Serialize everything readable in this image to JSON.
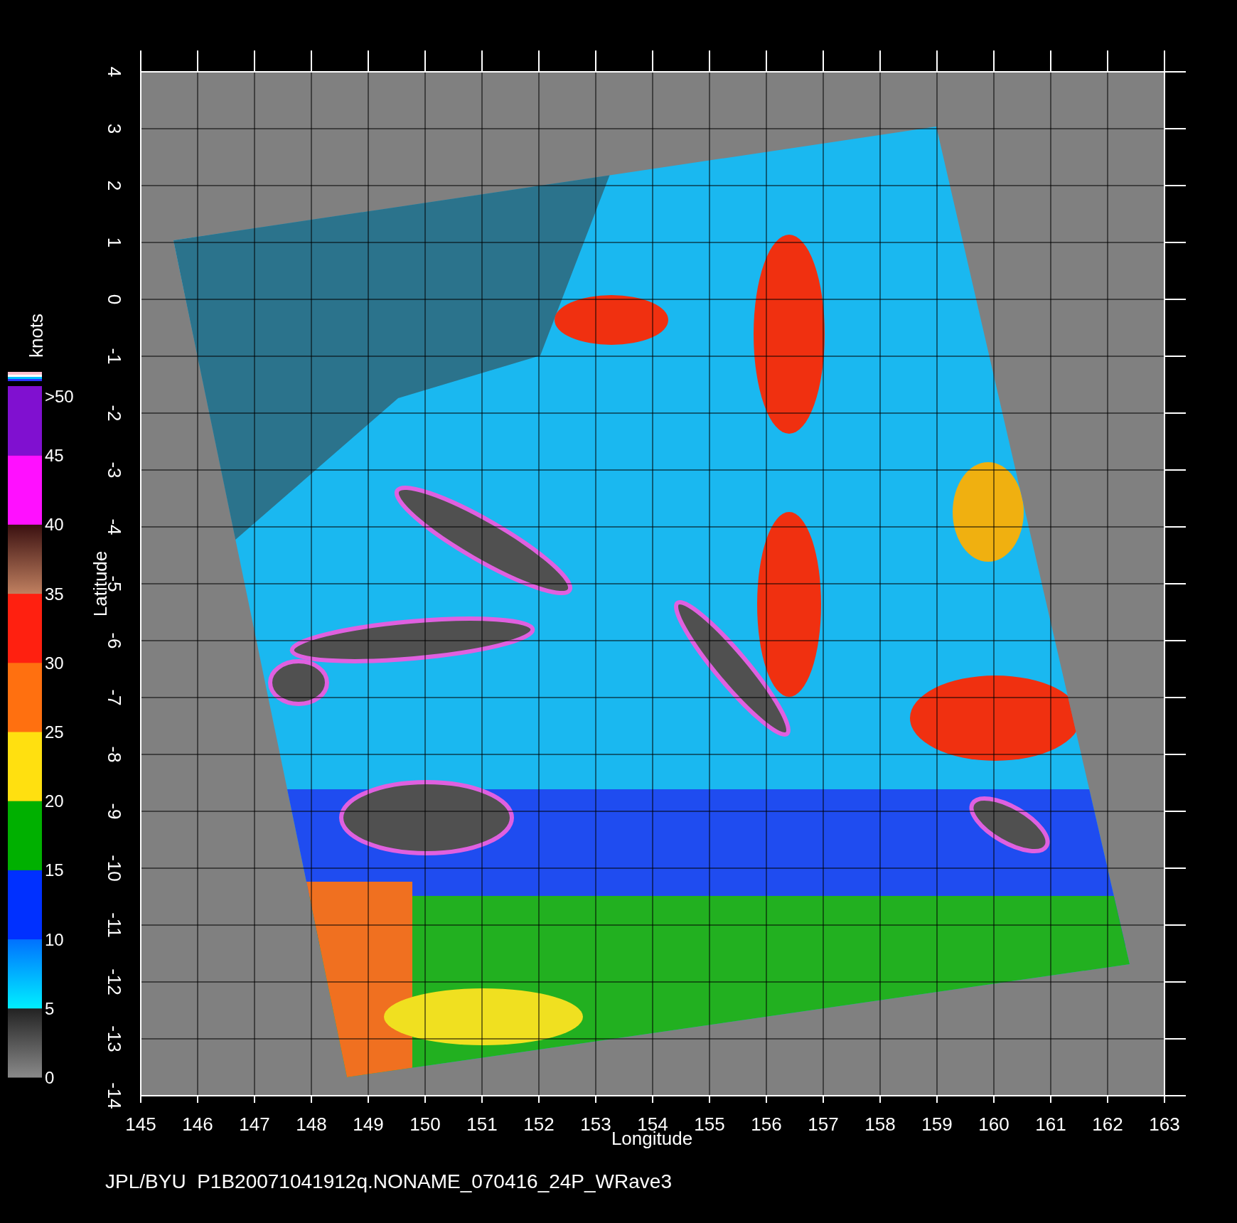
{
  "y_axis": {
    "title": "Latitude",
    "ticks": [
      "4",
      "3",
      "2",
      "1",
      "0",
      "-1",
      "-2",
      "-3",
      "-4",
      "-5",
      "-6",
      "-7",
      "-8",
      "-9",
      "-10",
      "-11",
      "-12",
      "-13",
      "-14"
    ]
  },
  "x_axis": {
    "title": "Longitude",
    "ticks": [
      "145",
      "146",
      "147",
      "148",
      "149",
      "150",
      "151",
      "152",
      "153",
      "154",
      "155",
      "156",
      "157",
      "158",
      "159",
      "160",
      "161",
      "162",
      "163"
    ]
  },
  "color_scale": {
    "unit": "knots",
    "labels": [
      ">50",
      "45",
      "40",
      "35",
      "30",
      "25",
      "20",
      "15",
      "10",
      "5",
      "0"
    ]
  },
  "footer": "JPL/BYU  P1B20071041912q.NONAME_070416_24P_WRave3"
}
